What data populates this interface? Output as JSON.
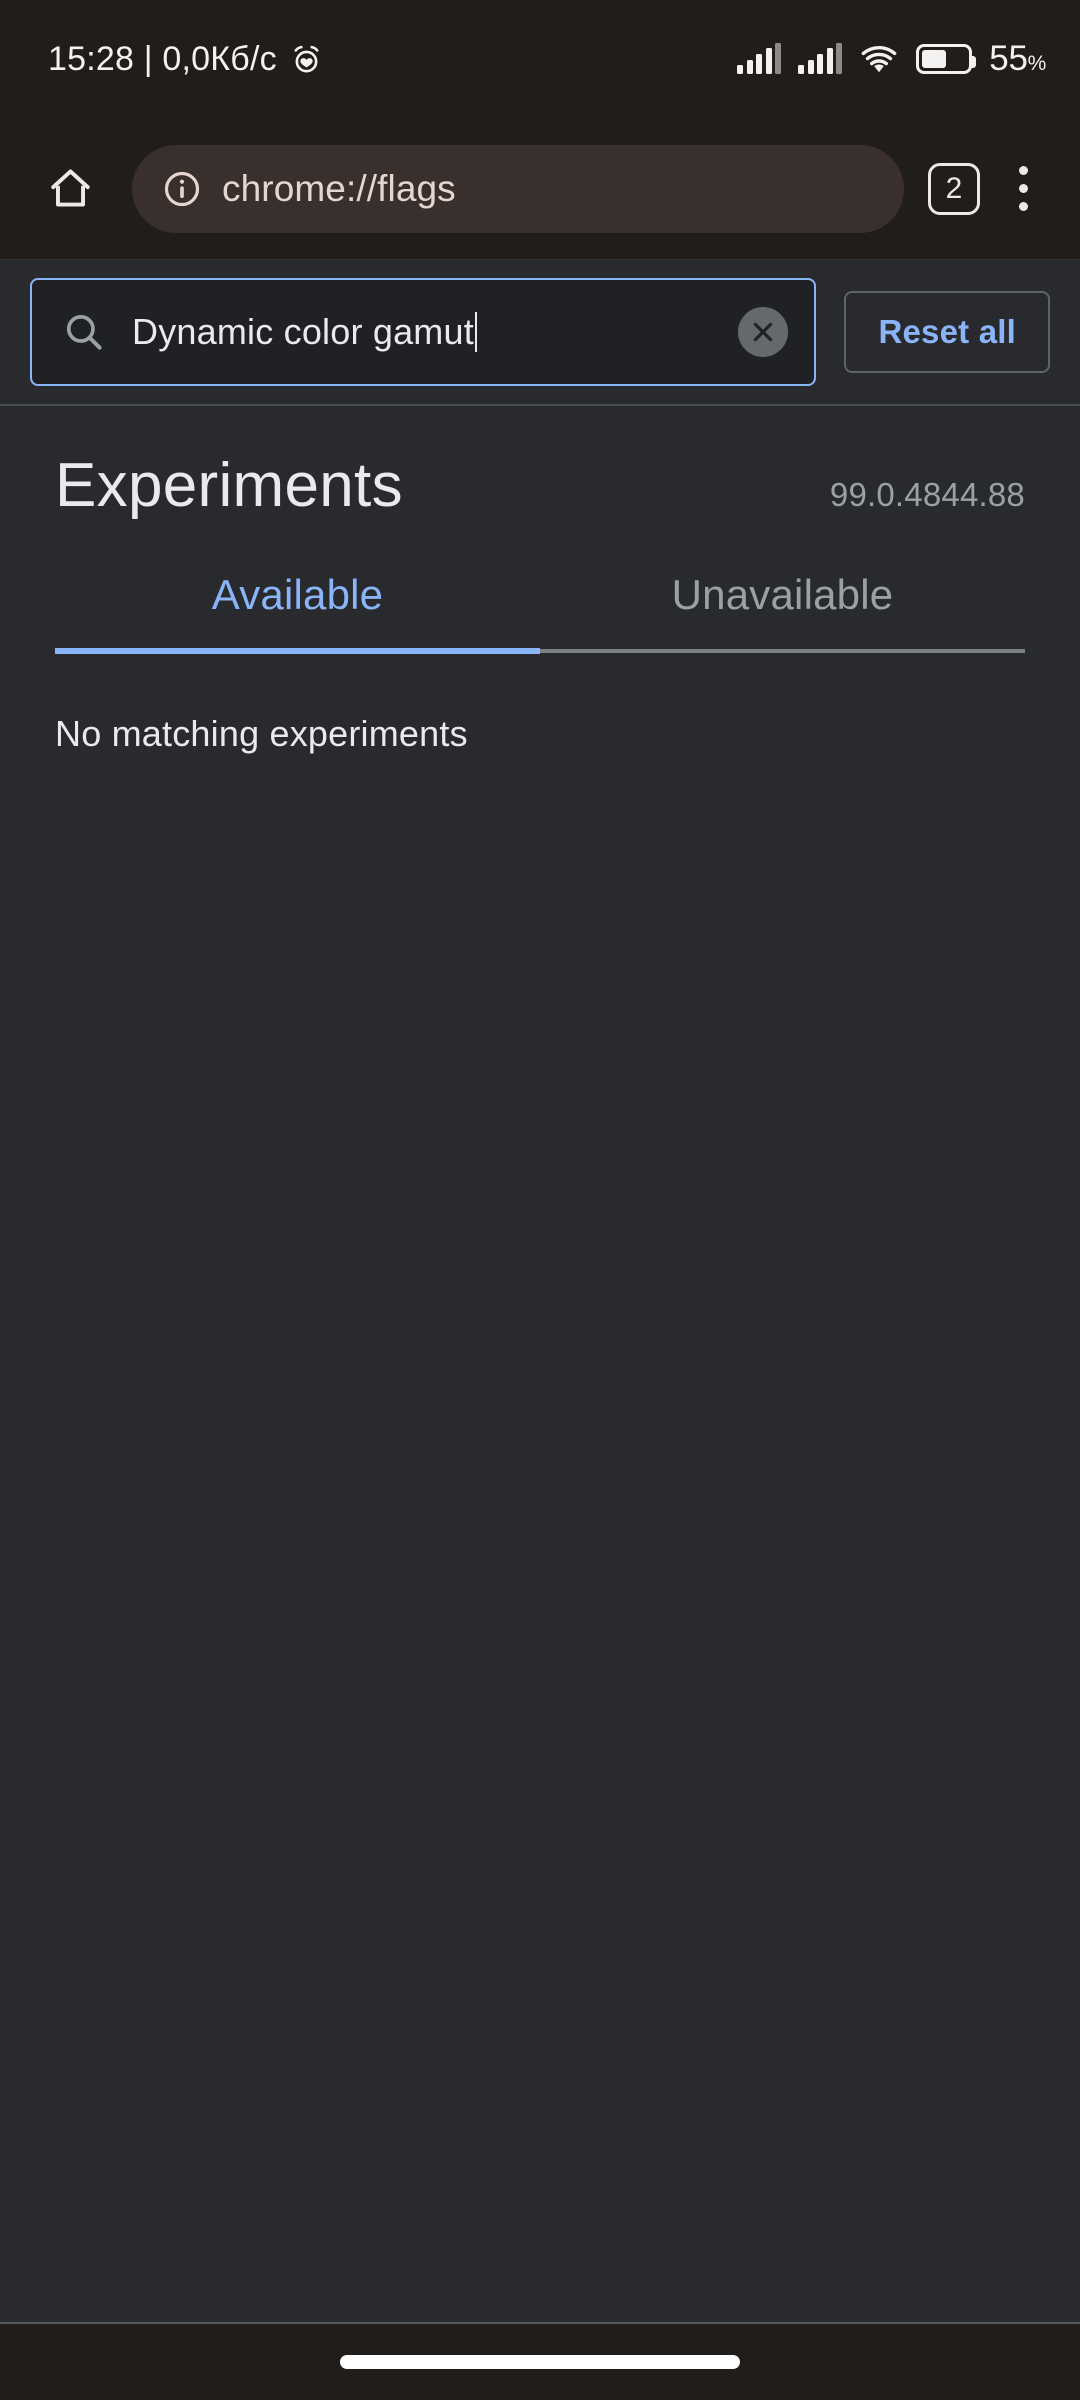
{
  "status_bar": {
    "clock_and_net": "15:28 | 0,0Кб/с",
    "alarm_icon": "alarm-clock-icon",
    "signal_icon_1": "cellular-signal-icon",
    "signal_icon_2": "cellular-signal-icon",
    "wifi_icon": "wifi-icon",
    "battery_icon": "battery-icon",
    "battery_percent": "55",
    "battery_percent_symbol": "%",
    "battery_level_fraction": 0.55
  },
  "toolbar": {
    "home_icon": "home-icon",
    "info_icon": "page-info-icon",
    "url": "chrome://flags",
    "tab_count": "2",
    "menu_icon": "more-vertical-icon"
  },
  "flags_search": {
    "search_icon": "search-icon",
    "query": "Dynamic color gamut",
    "clear_icon": "clear-close-icon",
    "reset_label": "Reset all"
  },
  "page": {
    "title": "Experiments",
    "version": "99.0.4844.88",
    "tabs": [
      {
        "label": "Available",
        "selected": true
      },
      {
        "label": "Unavailable",
        "selected": false
      }
    ],
    "empty_message": "No matching experiments"
  },
  "navigation_bar": {
    "gesture_pill": "gesture-nav-pill"
  },
  "colors": {
    "page_background": "#292a2d",
    "chrome_background": "#201d1b",
    "url_pill": "#392f2d",
    "accent_blue": "#8ab4f8",
    "muted_text": "#9aa0a6",
    "primary_text": "#e8eaed",
    "search_field_background": "#202124"
  }
}
